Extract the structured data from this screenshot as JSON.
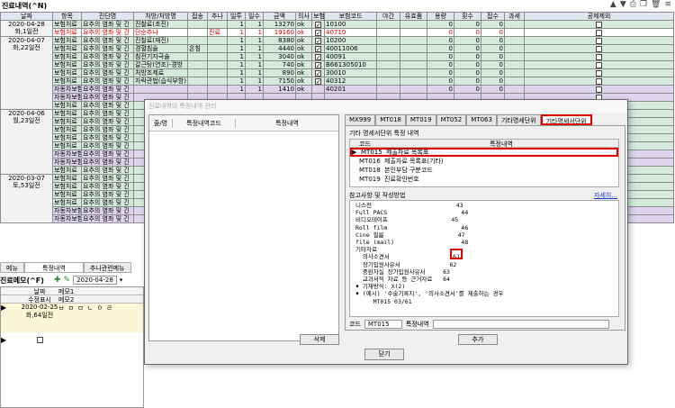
{
  "window": {
    "title": "진료내역(^N)"
  },
  "table": {
    "headers": [
      "날짜",
      "항목",
      "진단명",
      "처방/처방명",
      "접송",
      "추나",
      "일투",
      "일수",
      "금액",
      "의사",
      "보험",
      "보험코드",
      "야간",
      "유효품",
      "용량",
      "횟수",
      "접수",
      "과세",
      "공제제외"
    ],
    "dates": [
      {
        "d": "2020-04-28",
        "s": "화,1일전"
      },
      {
        "d": "2020-04-07",
        "s": "화,22일전"
      },
      {
        "d": "2020-04-06",
        "s": "월,23일전"
      },
      {
        "d": "2020-03-07",
        "s": "토,53일전"
      }
    ],
    "rows": [
      {
        "c": "보험처료",
        "dx": "요추의 염좌 및 긴",
        "rx": "진찰료(초진)",
        "o": "",
        "ch": "",
        "d1": "1",
        "d2": "1",
        "amt": "13270",
        "ok": "ok",
        "ins": true,
        "code": "10100",
        "n1": "0",
        "n2": "0",
        "n3": "0"
      },
      {
        "c": "보험처료",
        "dx": "요추의 염좌 및 긴",
        "rx": "단순추나",
        "o": "",
        "ch": "진료",
        "d1": "1",
        "d2": "1",
        "amt": "19160",
        "ok": "ok",
        "ins": true,
        "code": "40710",
        "n1": "0",
        "n2": "0",
        "n3": "0",
        "sel": true
      },
      {
        "c": "보험처료",
        "dx": "요추의 염좌 및 긴",
        "rx": "진찰료(재진)",
        "o": "",
        "ch": "",
        "d1": "1",
        "d2": "1",
        "amt": "8380",
        "ok": "ok",
        "ins": true,
        "code": "10200",
        "n1": "0",
        "n2": "0",
        "n3": "0"
      },
      {
        "c": "보험처료",
        "dx": "요추의 염좌 및 긴",
        "rx": "경혈침술",
        "o": "온침",
        "ch": "",
        "d1": "1",
        "d2": "1",
        "amt": "4440",
        "ok": "ok",
        "ins": true,
        "code": "40011006",
        "n1": "0",
        "n2": "0",
        "n3": "0"
      },
      {
        "c": "보험처료",
        "dx": "요추의 염좌 및 긴",
        "rx": "침전기자극술",
        "o": "",
        "ch": "",
        "d1": "1",
        "d2": "1",
        "amt": "3040",
        "ok": "ok",
        "ins": true,
        "code": "40091",
        "n1": "0",
        "n2": "0",
        "n3": "0"
      },
      {
        "c": "보험처료",
        "dx": "요추의 염좌 및 긴",
        "rx": "갈근탕(연조)-경방",
        "o": "",
        "ch": "",
        "d1": "1",
        "d2": "1",
        "amt": "740",
        "ok": "ok",
        "ins": true,
        "code": "B661305010",
        "n1": "0",
        "n2": "0",
        "n3": "0"
      },
      {
        "c": "보험처료",
        "dx": "요추의 염좌 및 긴",
        "rx": "처방조제료",
        "o": "",
        "ch": "",
        "d1": "1",
        "d2": "1",
        "amt": "890",
        "ok": "ok",
        "ins": true,
        "code": "30010",
        "n1": "0",
        "n2": "0",
        "n3": "0"
      },
      {
        "c": "보험처료",
        "dx": "요추의 염좌 및 긴",
        "rx": "자락관법(습식부항)",
        "o": "",
        "ch": "",
        "d1": "1",
        "d2": "1",
        "amt": "7150",
        "ok": "ok",
        "ins": true,
        "code": "40312",
        "n1": "0",
        "n2": "0",
        "n3": "0"
      },
      {
        "c": "자동차보험",
        "dx": "요추의 염좌 및 긴",
        "rx": "",
        "o": "",
        "ch": "",
        "d1": "1",
        "d2": "1",
        "amt": "1410",
        "ok": "ok",
        "ins": true,
        "code": "40201",
        "n1": "0",
        "n2": "0",
        "n3": "0",
        "purple": true
      },
      {
        "c": "자동차보험",
        "dx": "요추의 염좌 및 긴",
        "rx": "",
        "purple": true
      },
      {
        "c": "보험처료",
        "dx": "요추의 염좌 및 긴",
        "rx": ""
      },
      {
        "c": "보험처료",
        "dx": "요추의 염좌 및 긴",
        "rx": ""
      },
      {
        "c": "보험처료",
        "dx": "요추의 염좌 및 긴",
        "rx": ""
      },
      {
        "c": "보험처료",
        "dx": "요추의 염좌 및 긴",
        "rx": ""
      },
      {
        "c": "보험처료",
        "dx": "요추의 염좌 및 긴",
        "rx": ""
      },
      {
        "c": "보험처료",
        "dx": "요추의 염좌 및 긴",
        "rx": ""
      },
      {
        "c": "자동차보험",
        "dx": "요추의 염좌 및 긴",
        "rx": "",
        "purple": true
      },
      {
        "c": "자동차보험",
        "dx": "요추의 염좌 및 긴",
        "rx": "",
        "purple": true
      },
      {
        "c": "보험처료",
        "dx": "요추의 염좌 및 긴",
        "rx": ""
      },
      {
        "c": "보험처료",
        "dx": "요추의 염좌 및 긴",
        "rx": ""
      },
      {
        "c": "보험처료",
        "dx": "요추의 염좌 및 긴",
        "rx": ""
      },
      {
        "c": "보험처료",
        "dx": "요추의 염좌 및 긴",
        "rx": ""
      },
      {
        "c": "보험처료",
        "dx": "요추의 염좌 및 긴",
        "rx": ""
      },
      {
        "c": "자동차보험",
        "dx": "요추의 염좌 및 긴",
        "rx": "",
        "purple": true
      },
      {
        "c": "자동차보험",
        "dx": "요추의 염좌 및 긴",
        "rx": "",
        "purple": true
      }
    ]
  },
  "tabs": {
    "memo": "메뉴",
    "special": "특정내역",
    "chuna": "추나관련메뉴"
  },
  "memo": {
    "title": "진료메모(^F)",
    "date_value": "2020-04-28",
    "col_date": "날짜",
    "col_memo": "메모1",
    "col_display": "수정표시",
    "col_memo2": "메모2",
    "entry_date": "2020-02-25",
    "entry_sub": "화,64일전",
    "entry_text": "ㅂ ㅁ ㅁ ㄴ ㅇ ㄹ"
  },
  "dialog": {
    "title": "진료내역의 특정내역 관리",
    "left_cols": [
      "줄/명",
      "특정내역코드",
      "특정내역"
    ],
    "tabs": [
      "MX999",
      "MT018",
      "MT019",
      "MT052",
      "MT063",
      "기타명세단위",
      "기타명세서단위"
    ],
    "section_title": "기타 명세서단위 특정 내역",
    "grid_cols": [
      "코드",
      "특정내역"
    ],
    "grid_rows": [
      {
        "code": "MT015",
        "text": "제출자료 목록표"
      },
      {
        "code": "MT016",
        "text": "제출자료 목록표(기타)"
      },
      {
        "code": "MT018",
        "text": "본인부담 구분코드"
      },
      {
        "code": "MT019",
        "text": "진료확인번호"
      }
    ],
    "ref_label": "참고사항 및 작성방법",
    "detail_link": "자세히...",
    "ref_lines": [
      "니스전                        43",
      "Full PACS                     44",
      "비디오테이프                  45",
      "Roll film                     46",
      "Cine 필름                     47",
      "file (mail)                   48",
      "기타자료",
      "  의사소견서                  61",
      "  장기입원사유서              62",
      "  중환자실 장기입원사유서     63",
      "  교과서적 자료 등 근거자료   64",
      "♦ 기재방식: X(2)",
      "♦ (예시) '수술기록지', '의사소견서'를 제출하는 경우",
      "     MT015 03/61"
    ],
    "code_label": "코드",
    "code_value": "MT015",
    "special_label": "특정내역",
    "delete_btn": "삭제",
    "add_btn": "추가",
    "close_btn": "닫기"
  }
}
